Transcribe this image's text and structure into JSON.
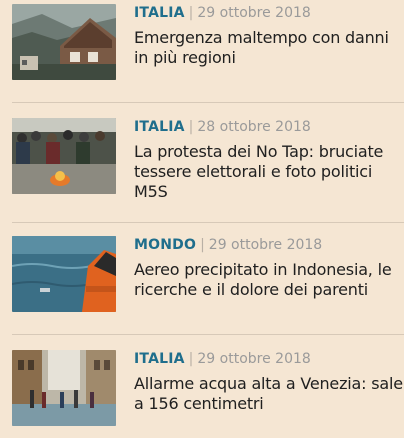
{
  "articles": [
    {
      "category": "ITALIA",
      "date": "29 ottobre 2018",
      "title": "Emergenza maltempo con danni in più regioni",
      "thumbnail": "mountain-village-photo"
    },
    {
      "category": "ITALIA",
      "date": "28 ottobre 2018",
      "title": "La protesta dei No Tap: bruciate tessere elettorali e foto politici M5S",
      "thumbnail": "protest-crowd-photo"
    },
    {
      "category": "MONDO",
      "date": "29 ottobre 2018",
      "title": "Aereo precipitato in Indonesia, le ricerche e il dolore dei parenti",
      "thumbnail": "sea-rescue-photo"
    },
    {
      "category": "ITALIA",
      "date": "29 ottobre 2018",
      "title": "Allarme acqua alta a Venezia: sale a 156 centimetri",
      "thumbnail": "venice-flood-photo"
    }
  ],
  "separator": "|",
  "colors": {
    "background": "#f5e6d3",
    "category": "#1f6e8c",
    "date": "#9a9a9a",
    "divider": "#d7c9b8"
  }
}
